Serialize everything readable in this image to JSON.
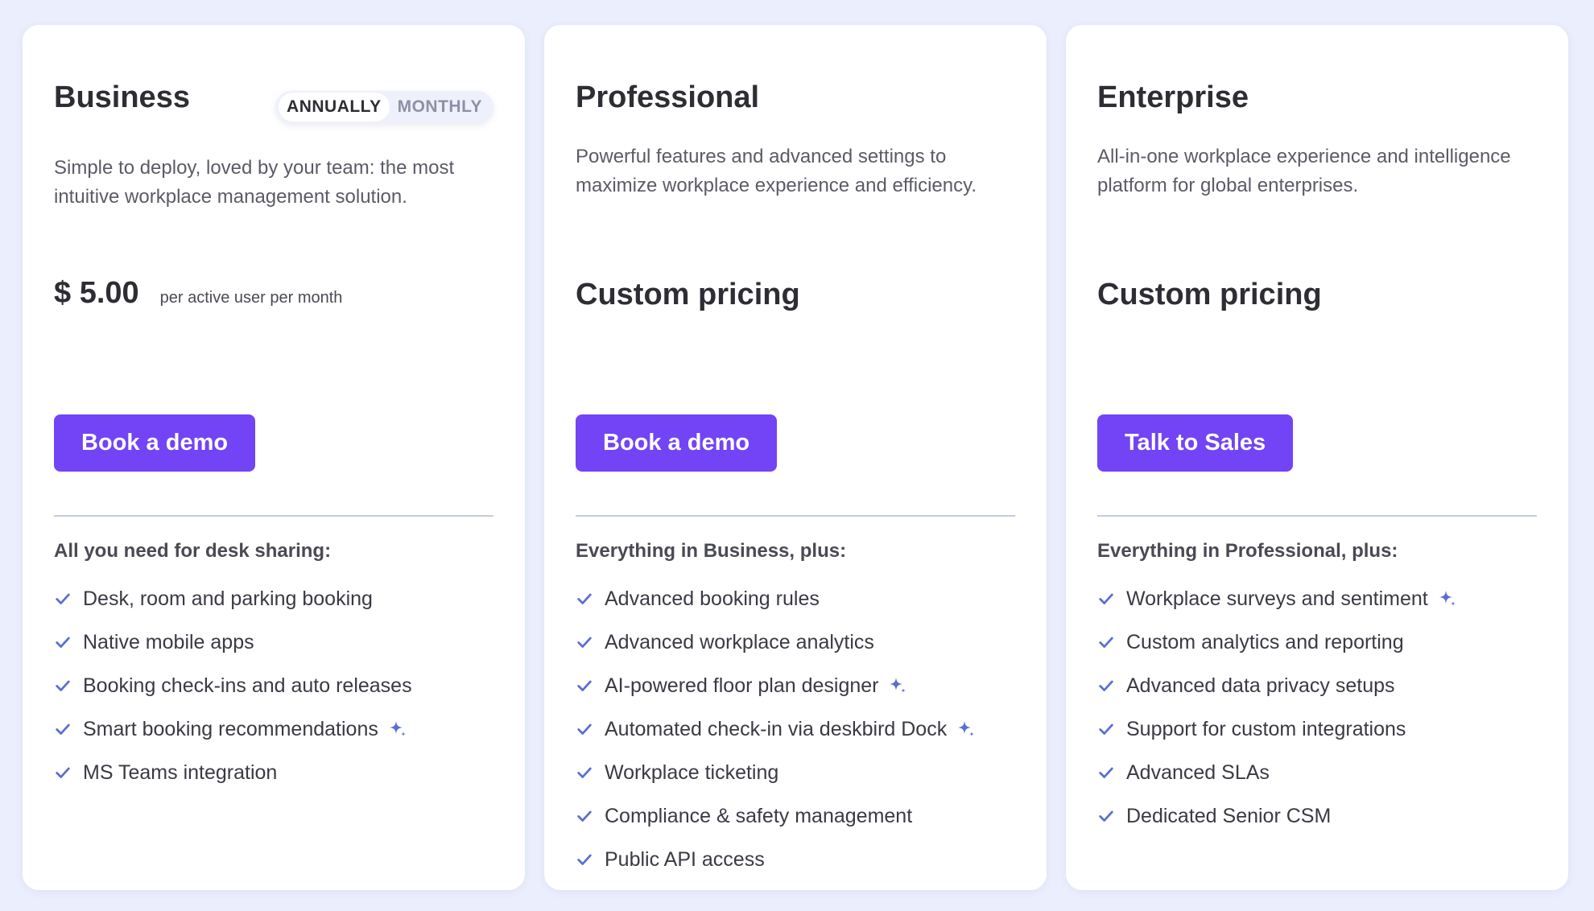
{
  "billing_toggle": {
    "annually": "ANNUALLY",
    "monthly": "MONTHLY",
    "selected": "annually"
  },
  "colors": {
    "accent": "#7244f5",
    "check": "#5a6fd0",
    "sparkle": "#5a6fd0",
    "background": "#ebeefc"
  },
  "plans": [
    {
      "title": "Business",
      "description": "Simple to deploy, loved by your team: the most intuitive workplace management solution.",
      "price": "$ 5.00",
      "price_unit": "per active user per month",
      "cta": "Book a demo",
      "features_heading": "All you need for desk sharing:",
      "features": [
        {
          "text": "Desk, room and parking booking",
          "ai": false
        },
        {
          "text": "Native mobile apps",
          "ai": false
        },
        {
          "text": "Booking check-ins and auto releases",
          "ai": false
        },
        {
          "text": "Smart booking recommendations",
          "ai": true
        },
        {
          "text": "MS Teams integration",
          "ai": false
        }
      ]
    },
    {
      "title": "Professional",
      "description": "Powerful features and advanced settings to maximize workplace experience and efficiency.",
      "price": "Custom pricing",
      "cta": "Book a demo",
      "features_heading": "Everything in Business, plus:",
      "features": [
        {
          "text": "Advanced booking rules",
          "ai": false
        },
        {
          "text": "Advanced workplace analytics",
          "ai": false
        },
        {
          "text": "AI-powered floor plan designer",
          "ai": true
        },
        {
          "text": "Automated check-in via deskbird Dock",
          "ai": true
        },
        {
          "text": "Workplace ticketing",
          "ai": false
        },
        {
          "text": "Compliance & safety management",
          "ai": false
        },
        {
          "text": "Public API access",
          "ai": false
        }
      ]
    },
    {
      "title": "Enterprise",
      "description": "All-in-one workplace experience and intelligence platform for global enterprises.",
      "price": "Custom pricing",
      "cta": "Talk to Sales",
      "features_heading": "Everything in Professional, plus:",
      "features": [
        {
          "text": "Workplace surveys and sentiment",
          "ai": true
        },
        {
          "text": "Custom analytics and reporting",
          "ai": false
        },
        {
          "text": "Advanced data privacy setups",
          "ai": false
        },
        {
          "text": "Support for custom integrations",
          "ai": false
        },
        {
          "text": "Advanced SLAs",
          "ai": false
        },
        {
          "text": "Dedicated Senior CSM",
          "ai": false
        }
      ]
    }
  ]
}
